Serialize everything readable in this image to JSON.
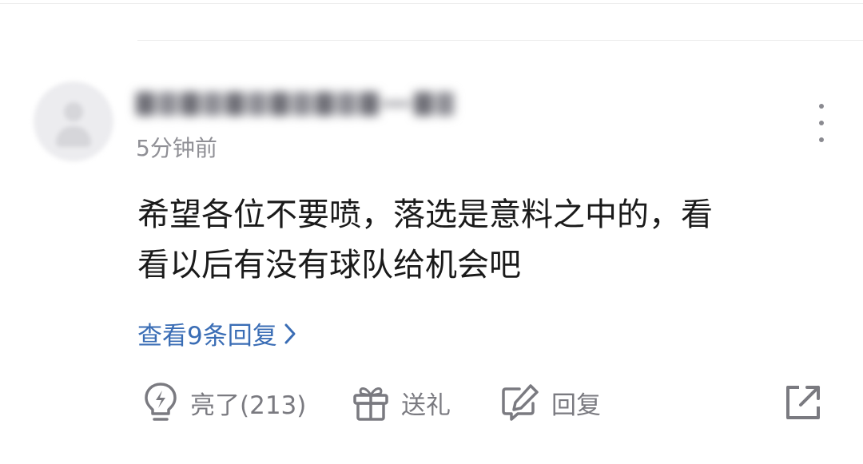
{
  "comment": {
    "timestamp": "5分钟前",
    "content_lines": [
      "希望各位不要喷，落选是意料之中的，看",
      "看以后有没有球队给机会吧"
    ],
    "replies_link": "查看9条回复"
  },
  "actions": {
    "like_label": "亮了(213)",
    "gift_label": "送礼",
    "reply_label": "回复"
  },
  "colors": {
    "link": "#3a6db5",
    "icon_gray": "#7a7a80",
    "text_main": "#1a1a1a",
    "text_muted": "#8f8f95"
  },
  "icons": [
    "avatar",
    "more-vertical-icon",
    "chevron-right-icon",
    "lightbulb-icon",
    "gift-icon",
    "edit-comment-icon",
    "share-icon"
  ]
}
